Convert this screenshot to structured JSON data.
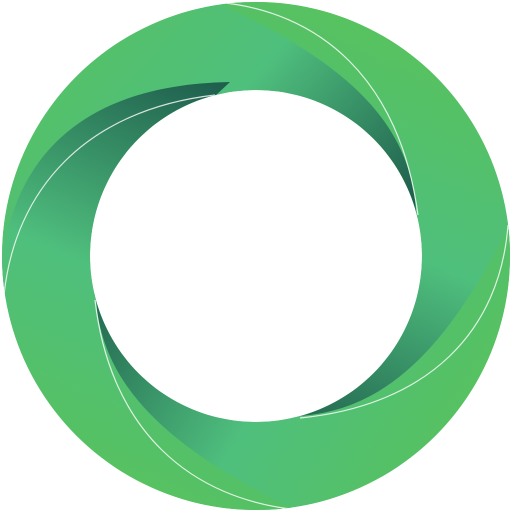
{
  "logo": {
    "icon": "green-swirl-ring-logo-icon",
    "colors": {
      "light_green": "#57c25c",
      "mid_green": "#4fbf7d",
      "dark_green": "#1f5f4e",
      "background": "#ffffff"
    }
  }
}
